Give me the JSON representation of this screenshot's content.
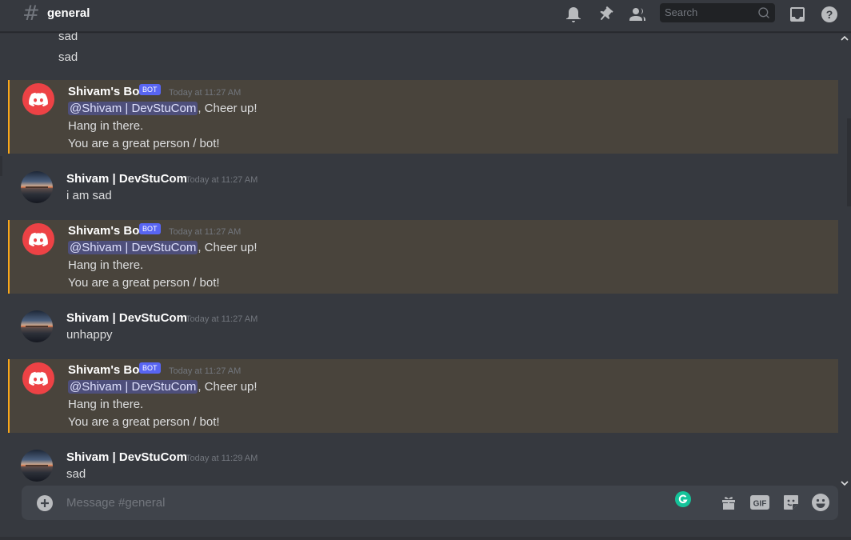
{
  "header": {
    "channel_name": "general",
    "search_placeholder": "Search"
  },
  "colors": {
    "background": "#36393f",
    "mention_highlight": "#49443c",
    "mention_border": "#faa81a",
    "bot_tag": "#5865f2",
    "bot_avatar": "#ed4245"
  },
  "messages": {
    "top_lines": [
      "sad",
      "sad"
    ],
    "m1": {
      "author": "Shivam's Bot",
      "tag": "BOT",
      "time": "Today at 11:27 AM",
      "mention": "@Shivam | DevStuCom",
      "line1_rest": ", Cheer up!",
      "line2": "Hang in there.",
      "line3": "You are a great person / bot!"
    },
    "m2": {
      "author": "Shivam | DevStuCom",
      "time": "Today at 11:27 AM",
      "text": "i am sad"
    },
    "m3": {
      "author": "Shivam's Bot",
      "tag": "BOT",
      "time": "Today at 11:27 AM",
      "mention": "@Shivam | DevStuCom",
      "line1_rest": ", Cheer up!",
      "line2": "Hang in there.",
      "line3": "You are a great person / bot!"
    },
    "m4": {
      "author": "Shivam | DevStuCom",
      "time": "Today at 11:27 AM",
      "text": "unhappy"
    },
    "m5": {
      "author": "Shivam's Bot",
      "tag": "BOT",
      "time": "Today at 11:27 AM",
      "mention": "@Shivam | DevStuCom",
      "line1_rest": ", Cheer up!",
      "line2": "Hang in there.",
      "line3": "You are a great person / bot!"
    },
    "m6": {
      "author": "Shivam | DevStuCom",
      "time": "Today at 11:29 AM",
      "text": "sad"
    }
  },
  "composer": {
    "placeholder": "Message #general",
    "gif_label": "GIF"
  },
  "icons": {
    "header": [
      "bell-icon",
      "pin-icon",
      "members-icon",
      "search-icon",
      "inbox-icon",
      "help-icon"
    ],
    "composer": [
      "plus-icon",
      "grammarly-icon",
      "gift-icon",
      "gif-icon",
      "sticker-icon",
      "emoji-icon"
    ]
  }
}
